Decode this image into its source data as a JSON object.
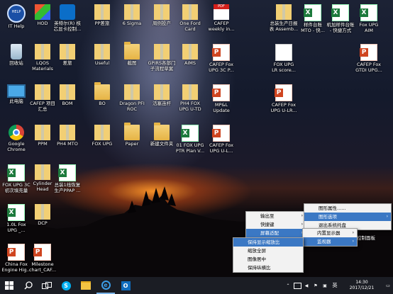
{
  "desktop_icons": [
    {
      "label": "IT Help",
      "glyph": "help"
    },
    {
      "label": "HOD",
      "glyph": "hod"
    },
    {
      "label": "英特尔(R) 核\n芯显卡控制...",
      "glyph": "app"
    },
    {
      "label": "PP差旅",
      "glyph": "zipfolder"
    },
    {
      "label": "6 Sigma",
      "glyph": "zipfolder"
    },
    {
      "label": "周例投产",
      "glyph": "zipfolder"
    },
    {
      "label": "One Ford\nCard",
      "glyph": "zipfolder"
    },
    {
      "label": "CAFEP\nweekly in...",
      "glyph": "pdf"
    },
    {
      "label": "总装生产日报\n表 Assemb...",
      "glyph": "zipfolder"
    },
    {
      "label": "样件台账\nMTO - 快...",
      "glyph": "excel"
    },
    {
      "label": "机加样件台账\n- 快捷方式",
      "glyph": "excel"
    },
    {
      "label": "Fox UPG\nAIM",
      "glyph": "excel"
    },
    {
      "label": "回收站",
      "glyph": "recycle"
    },
    {
      "label": "LQOS\nMaterials",
      "glyph": "zipfolder"
    },
    {
      "label": "差旅",
      "glyph": "zipfolder"
    },
    {
      "label": "Useful",
      "glyph": "zipfolder"
    },
    {
      "label": "截图",
      "glyph": "folder"
    },
    {
      "label": "GPIRS各部门\n子流程草案",
      "glyph": "zipfolder"
    },
    {
      "label": "AIMS",
      "glyph": "zipfolder"
    },
    {
      "label": "CAFEP Fox\nUPG 3C P...",
      "glyph": "ppt"
    },
    {
      "label": "FOX UPG\nLR score...",
      "glyph": "xml"
    },
    {
      "label": "CAFEP Fox\nGTDI UPG...",
      "glyph": "ppt"
    },
    {
      "label": "此电脑",
      "glyph": "pc"
    },
    {
      "label": "CAFEP 项目\n汇总",
      "glyph": "zipfolder"
    },
    {
      "label": "BOM",
      "glyph": "zipfolder"
    },
    {
      "label": "BO",
      "glyph": "folder"
    },
    {
      "label": "Dragon PFI\nROC",
      "glyph": "zipfolder"
    },
    {
      "label": "活塞连杆",
      "glyph": "zipfolder"
    },
    {
      "label": "PH4 FOX\nUPG U-TD",
      "glyph": "zipfolder"
    },
    {
      "label": "MP&L\nUpdate",
      "glyph": "ppt"
    },
    {
      "label": "CAFEP Fox\nUPG U-LR...",
      "glyph": "ppt"
    },
    {
      "label": "Google\nChrome",
      "glyph": "chrome"
    },
    {
      "label": "PPM",
      "glyph": "zipfolder"
    },
    {
      "label": "PH4 MTO",
      "glyph": "zipfolder"
    },
    {
      "label": "FOX UPG",
      "glyph": "zipfolder"
    },
    {
      "label": "Paper",
      "glyph": "folder"
    },
    {
      "label": "新建文件夹",
      "glyph": "folder"
    },
    {
      "label": "01 FOX UPG\nPTR Plan V...",
      "glyph": "excel"
    },
    {
      "label": "CAFEP Fox\nUPG U-L...",
      "glyph": "ppt"
    },
    {
      "label": "FOX UPG 3C\n初次填充量",
      "glyph": "excel"
    },
    {
      "label": "Cylinder\nHead",
      "glyph": "zipfolder"
    },
    {
      "label": "总装1线恢复\n生产PPAP ...",
      "glyph": "excel"
    },
    {
      "label": "1.0L Fox\nUPG _...",
      "glyph": "excel"
    },
    {
      "label": "DCP",
      "glyph": "zipfolder"
    },
    {
      "label": "China Fox\nEngine Hig...",
      "glyph": "ppt"
    },
    {
      "label": "Milestone\nchart_CAF...",
      "glyph": "ppt"
    }
  ],
  "context_menu": {
    "items": [
      "输出至",
      "快捷键",
      "屏幕适配"
    ],
    "submenu_graphics": [
      "图形属性......",
      "图形选项",
      "退出系统托盘"
    ],
    "submenu_display": [
      "内置显示器",
      "监视器"
    ],
    "submenu_monitor": [
      "保持显示缩放比",
      "缩放全屏",
      "图像居中",
      "保持纵横比"
    ],
    "partial_label": "控制面板"
  },
  "taskbar": {
    "time": "14:30",
    "date": "2017/12/21",
    "ime": "英"
  }
}
